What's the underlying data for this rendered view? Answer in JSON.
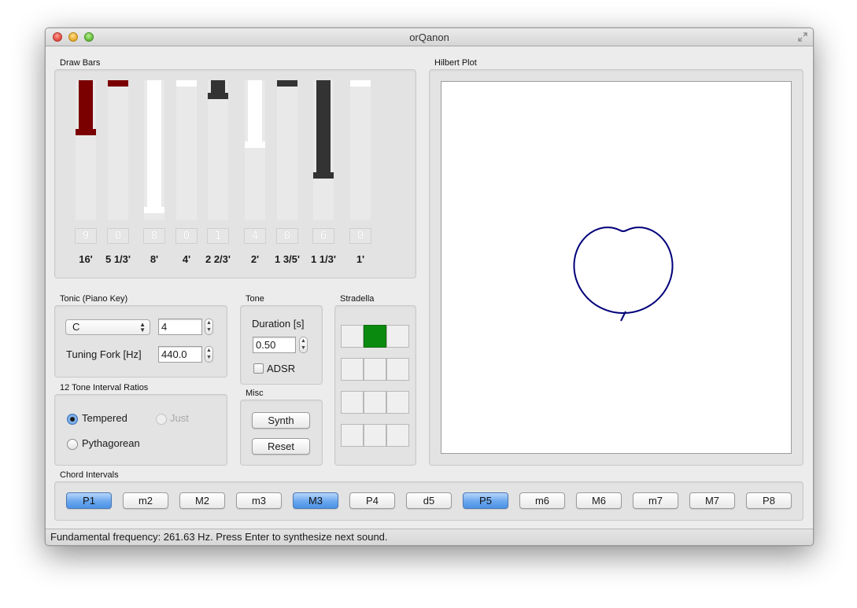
{
  "window": {
    "title": "orQanon"
  },
  "drawbars": {
    "label": "Draw Bars",
    "items": [
      {
        "label": "16'",
        "value": "9",
        "level": 0.39,
        "color": "#7a0000"
      },
      {
        "label": "5 1/3'",
        "value": "0",
        "level": 0.0,
        "color": "#7a0000"
      },
      {
        "label": "8'",
        "value": "8",
        "level": 0.97,
        "color": "#ffffff"
      },
      {
        "label": "4'",
        "value": "0",
        "level": 0.0,
        "color": "#ffffff"
      },
      {
        "label": "2 2/3'",
        "value": "1",
        "level": 0.12,
        "color": "#333333"
      },
      {
        "label": "2'",
        "value": "4",
        "level": 0.48,
        "color": "#ffffff"
      },
      {
        "label": "1 3/5'",
        "value": "0",
        "level": 0.0,
        "color": "#333333"
      },
      {
        "label": "1 1/3'",
        "value": "6",
        "level": 0.71,
        "color": "#333333"
      },
      {
        "label": "1'",
        "value": "0",
        "level": 0.0,
        "color": "#ffffff"
      }
    ]
  },
  "tonic": {
    "label": "Tonic (Piano Key)",
    "key": "C",
    "octave": "4",
    "tuning_label": "Tuning Fork [Hz]",
    "tuning_value": "440.0"
  },
  "tone": {
    "label": "Tone",
    "duration_label": "Duration [s]",
    "duration_value": "0.50",
    "adsr_label": "ADSR"
  },
  "stradella": {
    "label": "Stradella",
    "active_row": 0,
    "active_col": 1
  },
  "ratios": {
    "label": "12 Tone Interval Ratios",
    "tempered": "Tempered",
    "just": "Just",
    "pythagorean": "Pythagorean"
  },
  "misc": {
    "label": "Misc",
    "synth": "Synth",
    "reset": "Reset"
  },
  "hilbert": {
    "label": "Hilbert Plot",
    "curve_color": "#00007a"
  },
  "chords": {
    "label": "Chord Intervals",
    "items": [
      {
        "label": "P1",
        "active": true
      },
      {
        "label": "m2",
        "active": false
      },
      {
        "label": "M2",
        "active": false
      },
      {
        "label": "m3",
        "active": false
      },
      {
        "label": "M3",
        "active": true
      },
      {
        "label": "P4",
        "active": false
      },
      {
        "label": "d5",
        "active": false
      },
      {
        "label": "P5",
        "active": true
      },
      {
        "label": "m6",
        "active": false
      },
      {
        "label": "M6",
        "active": false
      },
      {
        "label": "m7",
        "active": false
      },
      {
        "label": "M7",
        "active": false
      },
      {
        "label": "P8",
        "active": false
      }
    ]
  },
  "status": "Fundamental frequency: 261.63 Hz. Press Enter to synthesize next sound."
}
